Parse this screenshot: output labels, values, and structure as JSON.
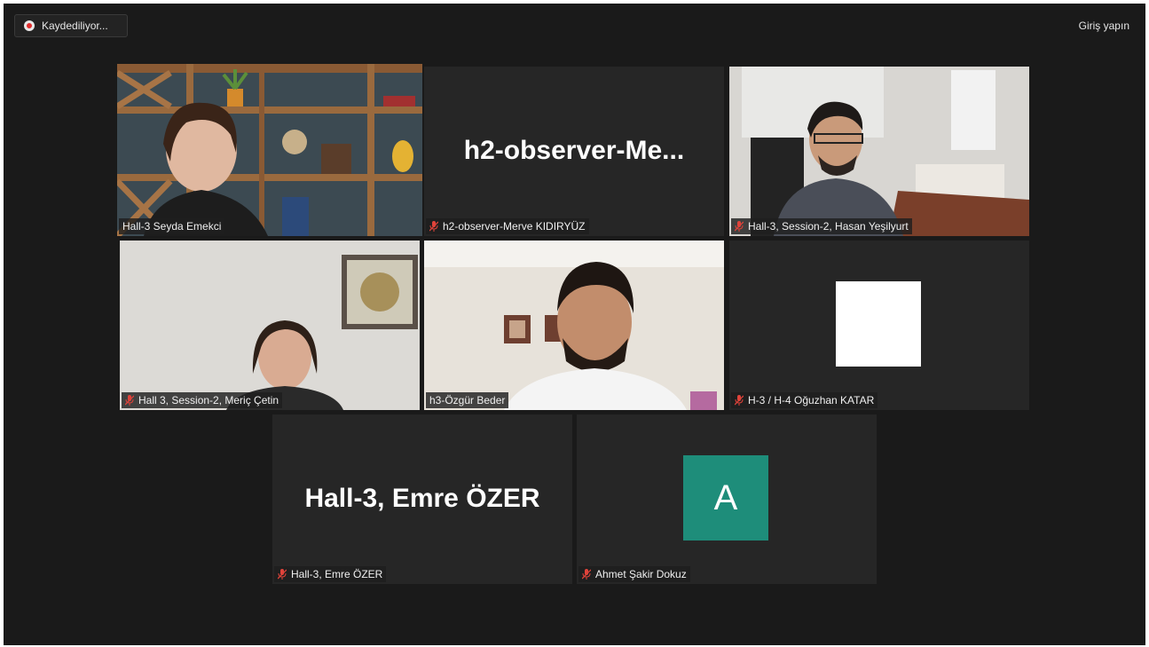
{
  "toolbar": {
    "recording_label": "Kaydediliyor...",
    "signin_label": "Giriş yapın"
  },
  "participants": [
    {
      "name": "Hall-3 Seyda Emekci",
      "muted": false,
      "active": true,
      "display": "video"
    },
    {
      "name": "h2-observer-Merve KIDIRYÜZ",
      "muted": true,
      "display": "text",
      "big_text": "h2-observer-Me..."
    },
    {
      "name": "Hall-3, Session-2, Hasan Yeşilyurt",
      "muted": true,
      "display": "video"
    },
    {
      "name": "Hall 3, Session-2, Meriç Çetin",
      "muted": true,
      "display": "video"
    },
    {
      "name": "h3-Özgür Beder",
      "muted": false,
      "display": "video"
    },
    {
      "name": "H-3 / H-4 Oğuzhan KATAR",
      "muted": true,
      "display": "image"
    },
    {
      "name": "Hall-3, Emre ÖZER",
      "muted": true,
      "display": "text",
      "big_text": "Hall-3, Emre ÖZER"
    },
    {
      "name": "Ahmet Şakir Dokuz",
      "muted": true,
      "display": "avatar",
      "avatar_letter": "A"
    }
  ],
  "colors": {
    "active_border": "#c7e86a",
    "avatar_bg": "#1e8d7a",
    "muted_icon": "#e0433a",
    "record_dot": "#e02d2d"
  }
}
